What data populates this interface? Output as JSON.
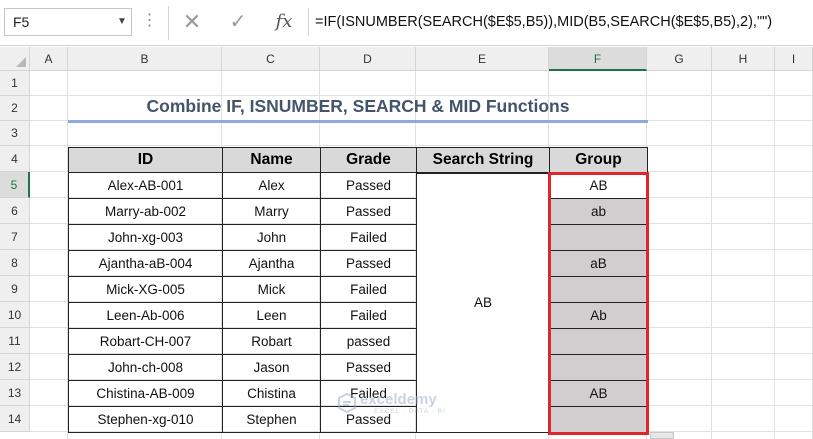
{
  "formula_bar": {
    "name_box": "F5",
    "cancel_icon": "✕",
    "enter_icon": "✓",
    "fx_label": "fx",
    "formula": "=IF(ISNUMBER(SEARCH($E$5,B5)),MID(B5,SEARCH($E$5,B5),2),\"\")"
  },
  "columns": [
    "A",
    "B",
    "C",
    "D",
    "E",
    "F",
    "G",
    "H",
    "I"
  ],
  "selected_column": "F",
  "rows": [
    "1",
    "2",
    "3",
    "4",
    "5",
    "6",
    "7",
    "8",
    "9",
    "10",
    "11",
    "12",
    "13",
    "14"
  ],
  "selected_row": "5",
  "sheet": {
    "title": "Combine IF, ISNUMBER, SEARCH & MID Functions",
    "headers": {
      "id": "ID",
      "name": "Name",
      "grade": "Grade",
      "search_string": "Search String",
      "group": "Group"
    },
    "search_string_value": "AB",
    "records": [
      {
        "id": "Alex-AB-001",
        "name": "Alex",
        "grade": "Passed",
        "group": "AB"
      },
      {
        "id": "Marry-ab-002",
        "name": "Marry",
        "grade": "Passed",
        "group": "ab"
      },
      {
        "id": "John-xg-003",
        "name": "John",
        "grade": "Failed",
        "group": ""
      },
      {
        "id": "Ajantha-aB-004",
        "name": "Ajantha",
        "grade": "Passed",
        "group": "aB"
      },
      {
        "id": "Mick-XG-005",
        "name": "Mick",
        "grade": "Failed",
        "group": ""
      },
      {
        "id": "Leen-Ab-006",
        "name": "Leen",
        "grade": "Failed",
        "group": "Ab"
      },
      {
        "id": "Robart-CH-007",
        "name": "Robart",
        "grade": "passed",
        "group": ""
      },
      {
        "id": "John-ch-008",
        "name": "Jason",
        "grade": "Passed",
        "group": ""
      },
      {
        "id": "Chistina-AB-009",
        "name": "Chistina",
        "grade": "Failed",
        "group": "AB"
      },
      {
        "id": "Stephen-xg-010",
        "name": "Stephen",
        "grade": "Passed",
        "group": ""
      }
    ]
  },
  "watermark": {
    "name": "exceldemy",
    "tagline": "EXCEL · DATA · BI"
  },
  "colors": {
    "title": "#44546a",
    "title_underline": "#8ea9db",
    "header_fill": "#d9d9d9",
    "group_fill": "#d0cece",
    "highlight_border": "#e0252b",
    "selection": "#217346"
  }
}
